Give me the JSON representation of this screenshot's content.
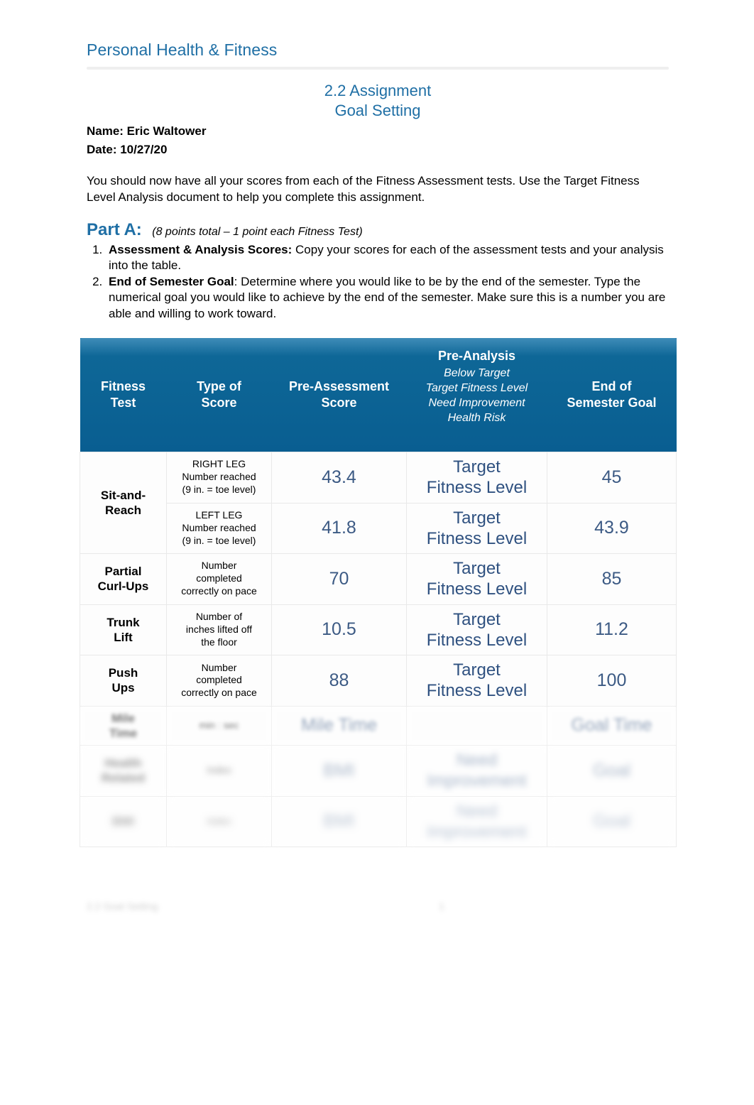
{
  "document": {
    "running_header": "Personal Health & Fitness",
    "title_line1": "2.2 Assignment",
    "title_line2": "Goal Setting",
    "name_label": "Name: Eric Waltower",
    "date_label": "Date: 10/27/20",
    "intro": "You should now have all your scores from each of the Fitness Assessment tests.  Use the Target Fitness Level Analysis document to help you complete this assignment.",
    "accent_color": "#1F6FA5",
    "value_color": "#3C5A84",
    "table_header_color": "#0E6797"
  },
  "part_a": {
    "label": "Part A:",
    "points": "(8  points total – 1 point each Fitness Test)",
    "steps": [
      {
        "bold": "Assessment & Analysis Scores:",
        "rest": " Copy your scores for each of the assessment tests and your analysis into the table."
      },
      {
        "bold": "End of Semester Goal",
        "rest": ":  Determine where you would like to be by the end of the semester.  Type the numerical goal you would like to achieve by the end of the semester.  Make sure this is a number you are able and willing to work toward."
      }
    ]
  },
  "table": {
    "headers": {
      "col1": "Fitness\nTest",
      "col1_line1": "Fitness",
      "col1_line2": "Test",
      "col2_line1": "Type of",
      "col2_line2": "Score",
      "col3_line1": "Pre-Assessment",
      "col3_line2": "Score",
      "col4_title": "Pre-Analysis",
      "col4_options": [
        "Below Target",
        "Target Fitness Level",
        "Need Improvement",
        "Health Risk"
      ],
      "col5_line1": "End of",
      "col5_line2": "Semester Goal"
    },
    "rows": [
      {
        "test_line1": "Sit-and-",
        "test_line2": "Reach",
        "type_line1": "RIGHT LEG",
        "type_line2": "Number reached",
        "type_line3": "(9 in. = toe level)",
        "pre_score": "43.4",
        "analysis_line1": "Target",
        "analysis_line2": "Fitness Level",
        "goal": "45",
        "blur": ""
      },
      {
        "test_line1": "",
        "test_line2": "",
        "type_line1": "LEFT LEG",
        "type_line2": "Number reached",
        "type_line3": "(9 in. = toe level)",
        "pre_score": "41.8",
        "analysis_line1": "Target",
        "analysis_line2": "Fitness Level",
        "goal": "43.9",
        "blur": ""
      },
      {
        "test_line1": "Partial",
        "test_line2": "Curl-Ups",
        "type_line1": "Number",
        "type_line2": "completed",
        "type_line3": "correctly on pace",
        "pre_score": "70",
        "analysis_line1": "Target",
        "analysis_line2": "Fitness Level",
        "goal": "85",
        "blur": ""
      },
      {
        "test_line1": "Trunk",
        "test_line2": "Lift",
        "type_line1": "Number of",
        "type_line2": "inches lifted off",
        "type_line3": "the floor",
        "pre_score": "10.5",
        "analysis_line1": "Target",
        "analysis_line2": "Fitness Level",
        "goal": "11.2",
        "blur": ""
      },
      {
        "test_line1": "Push",
        "test_line2": "Ups",
        "type_line1": "Number",
        "type_line2": "completed",
        "type_line3": "correctly on pace",
        "pre_score": "88",
        "analysis_line1": "Target",
        "analysis_line2": "Fitness Level",
        "goal": "100",
        "blur": ""
      },
      {
        "test_line1": "Mile",
        "test_line2": "Time",
        "type_line1": "",
        "type_line2": "min : sec",
        "type_line3": "",
        "pre_score": "Mile Time",
        "analysis_line1": "",
        "analysis_line2": "",
        "goal": "Goal Time",
        "blur": "blur1"
      },
      {
        "test_line1": "Health",
        "test_line2": "Related",
        "type_line1": "",
        "type_line2": "Index",
        "type_line3": "",
        "pre_score": "BMI",
        "analysis_line1": "Need Improvement",
        "analysis_line2": "",
        "goal": "Goal",
        "blur": "blur2"
      },
      {
        "test_line1": "BMI",
        "test_line2": "",
        "type_line1": "",
        "type_line2": "Index",
        "type_line3": "",
        "pre_score": "BMI",
        "analysis_line1": "Need Improvement",
        "analysis_line2": "",
        "goal": "Goal",
        "blur": "blur3"
      }
    ]
  },
  "footer": {
    "left": "2.2 Goal Setting",
    "page": "1"
  }
}
